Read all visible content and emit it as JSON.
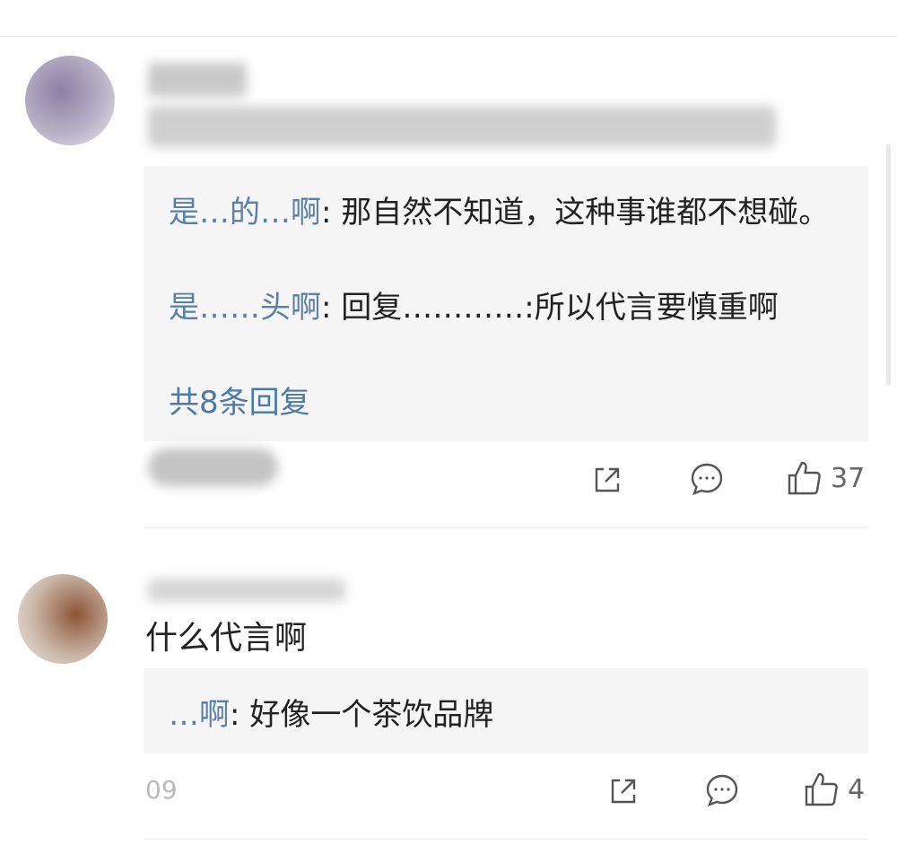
{
  "comments": [
    {
      "replies": [
        {
          "author": "是…的…啊",
          "text": ": 那自然不知道，这种事谁都不想碰。"
        },
        {
          "author": "是……头啊",
          "text": ": 回复…………:所以代言要慎重啊"
        }
      ],
      "more_replies": "共8条回复",
      "actions": {
        "share": "share-icon",
        "comment": "comment-icon",
        "like": "like-icon"
      },
      "like_count": "37"
    },
    {
      "text": "什么代言啊",
      "replies": [
        {
          "author": "…啊",
          "text": ": 好像一个茶饮品牌"
        }
      ],
      "time": "09",
      "actions": {
        "share": "share-icon",
        "comment": "comment-icon",
        "like": "like-icon"
      },
      "like_count": "4"
    }
  ],
  "colors": {
    "link": "#4d79a7",
    "reply_bg": "#f5f5f5"
  }
}
